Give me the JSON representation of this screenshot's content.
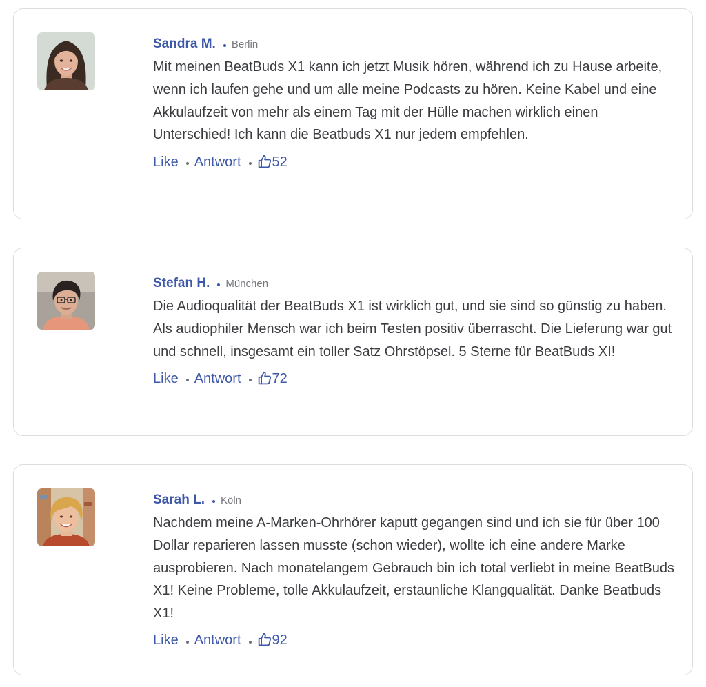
{
  "comments": [
    {
      "name": "Sandra M.",
      "city": "Berlin",
      "text": "Mit meinen BeatBuds X1 kann ich jetzt Musik hören, während ich zu Hause arbeite, wenn ich laufen gehe und um alle meine Podcasts zu hören. Keine Kabel und eine Akkulaufzeit von mehr als einem Tag mit der Hülle machen wirklich einen Unterschied! Ich kann die Beatbuds X1 nur jedem empfehlen.",
      "like_label": "Like",
      "reply_label": "Antwort",
      "likes": "52"
    },
    {
      "name": "Stefan H.",
      "city": "München",
      "text": "Die Audioqualität der BeatBuds X1 ist wirklich gut, und sie sind so günstig zu haben. Als audiophiler Mensch war ich beim Testen positiv überrascht. Die Lieferung war gut und schnell, insgesamt ein toller Satz Ohrstöpsel. 5 Sterne für BeatBuds XI!",
      "like_label": "Like",
      "reply_label": "Antwort",
      "likes": "72"
    },
    {
      "name": "Sarah L.",
      "city": "Köln",
      "text": "Nachdem meine A-Marken-Ohrhörer kaputt gegangen sind und ich sie für über 100 Dollar reparieren lassen musste (schon wieder), wollte ich eine andere Marke ausprobieren. Nach monatelangem Gebrauch bin ich total verliebt in meine BeatBuds X1! Keine Probleme, tolle Akkulaufzeit, erstaunliche Klangqualität. Danke Beatbuds X1!",
      "like_label": "Like",
      "reply_label": "Antwort",
      "likes": "92"
    }
  ],
  "colors": {
    "accent": "#3d58a8",
    "body_text": "#3a3c40",
    "muted": "#76787c",
    "card_border": "#dcdde0"
  },
  "icons": {
    "like_count": "thumbs-up-icon"
  }
}
